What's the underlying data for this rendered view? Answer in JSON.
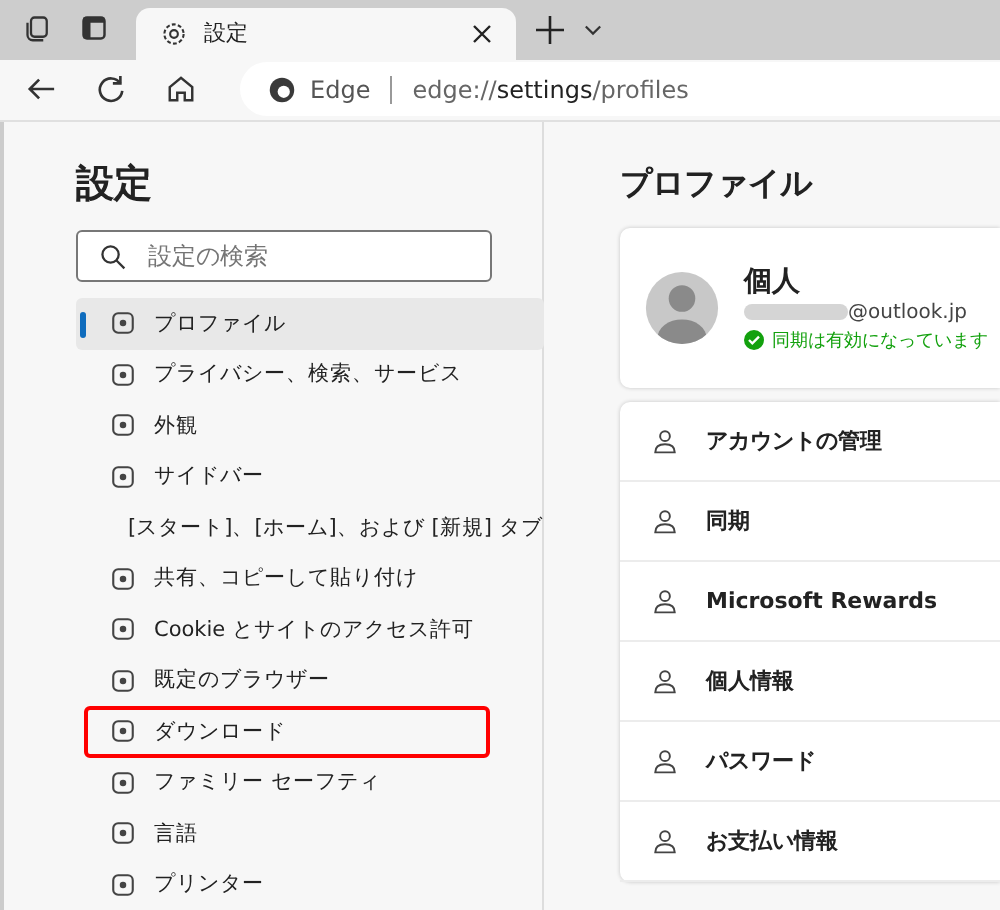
{
  "tab": {
    "title": "設定"
  },
  "address_bar": {
    "site": "Edge",
    "url": "edge://**settings**/profiles"
  },
  "sidebar": {
    "title": "設定",
    "search": {
      "placeholder": "設定の検索"
    },
    "items": [
      {
        "label": "プロファイル",
        "selected": true,
        "highlighted": false
      },
      {
        "label": "プライバシー、検索、サービス",
        "selected": false,
        "highlighted": false
      },
      {
        "label": "外観",
        "selected": false,
        "highlighted": false
      },
      {
        "label": "サイドバー",
        "selected": false,
        "highlighted": false
      },
      {
        "label": "[スタート]、[ホーム]、および [新規] タブ",
        "selected": false,
        "highlighted": false
      },
      {
        "label": "共有、コピーして貼り付け",
        "selected": false,
        "highlighted": false
      },
      {
        "label": "Cookie とサイトのアクセス許可",
        "selected": false,
        "highlighted": false
      },
      {
        "label": "既定のブラウザー",
        "selected": false,
        "highlighted": false
      },
      {
        "label": "ダウンロード",
        "selected": false,
        "highlighted": true
      },
      {
        "label": "ファミリー セーフティ",
        "selected": false,
        "highlighted": false
      },
      {
        "label": "言語",
        "selected": false,
        "highlighted": false
      },
      {
        "label": "プリンター",
        "selected": false,
        "highlighted": false
      }
    ]
  },
  "main": {
    "title": "プロファイル",
    "profile": {
      "name": "個人",
      "email": "@outlook.jp",
      "sync_status": "同期は有効になっています"
    },
    "rows": [
      {
        "label": "アカウントの管理"
      },
      {
        "label": "同期"
      },
      {
        "label": "Microsoft Rewards"
      },
      {
        "label": "個人情報"
      },
      {
        "label": "パスワード"
      },
      {
        "label": "お支払い情報"
      }
    ]
  }
}
